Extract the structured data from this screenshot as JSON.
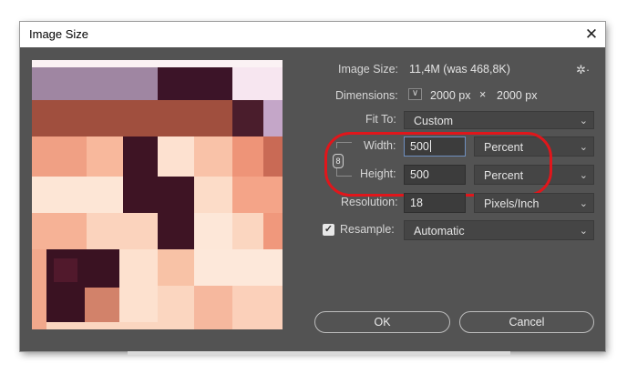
{
  "window": {
    "title": "Image Size",
    "close_glyph": "✕"
  },
  "settings": {
    "gear_glyph": "✲·"
  },
  "image_size": {
    "label": "Image Size:",
    "value": "11,4M (was 468,8K)"
  },
  "dimensions": {
    "label": "Dimensions:",
    "toggle_glyph": "∨",
    "width": "2000 px",
    "times": "×",
    "height": "2000 px"
  },
  "fit_to": {
    "label": "Fit To:",
    "value": "Custom"
  },
  "width": {
    "label": "Width:",
    "value": "500",
    "unit": "Percent"
  },
  "height": {
    "label": "Height:",
    "value": "500",
    "unit": "Percent"
  },
  "constrain": {
    "glyph": "8"
  },
  "resolution": {
    "label": "Resolution:",
    "value": "18",
    "unit": "Pixels/Inch"
  },
  "resample": {
    "label": "Resample:",
    "checked_glyph": "✓",
    "value": "Automatic"
  },
  "buttons": {
    "ok": "OK",
    "cancel": "Cancel"
  },
  "chevron": "⌄"
}
